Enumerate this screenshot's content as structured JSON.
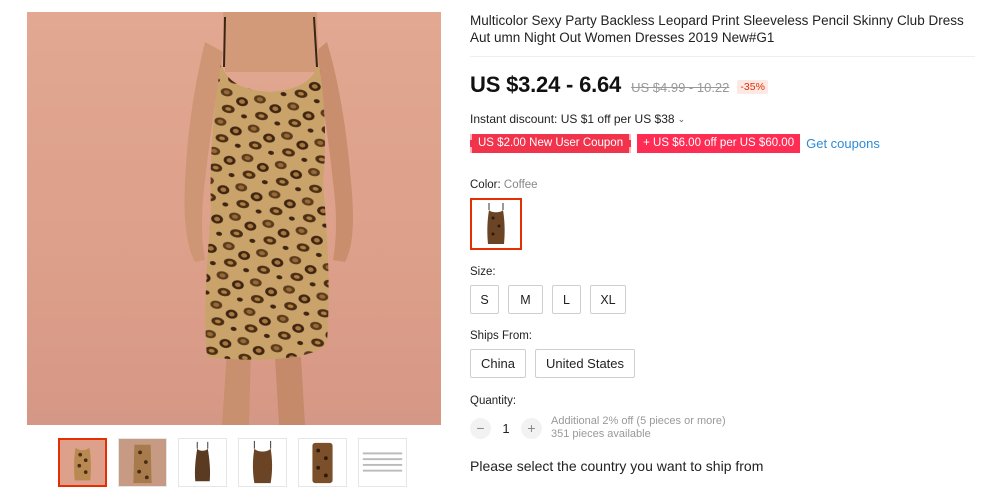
{
  "product": {
    "title": "Multicolor Sexy Party Backless Leopard Print Sleeveless Pencil Skinny Club Dress Aut umn Night Out Women Dresses 2019 New#G1",
    "price": "US $3.24 - 6.64",
    "original_price": "US $4.99 - 10.22",
    "discount": "-35%"
  },
  "promotions": {
    "instant_discount": "Instant discount: US $1 off per US $38",
    "coupon_new_user": "US $2.00 New User Coupon",
    "coupon_store": "+ US $6.00 off per US $60.00",
    "get_coupons": "Get coupons"
  },
  "color": {
    "label": "Color:",
    "selected": "Coffee"
  },
  "size": {
    "label": "Size:",
    "options": [
      "S",
      "M",
      "L",
      "XL"
    ]
  },
  "ships_from": {
    "label": "Ships From:",
    "options": [
      "China",
      "United States"
    ]
  },
  "quantity": {
    "label": "Quantity:",
    "value": "1",
    "decrease": "−",
    "increase": "+",
    "note": "Additional 2% off (5 pieces or more)",
    "available": "351 pieces available"
  },
  "shipping": {
    "prompt": "Please select the country you want to ship from"
  },
  "colors": {
    "accent": "#e62e04",
    "coupon": "#f1334c",
    "link": "#2d8bd8",
    "background_photo": "#dfa38d"
  },
  "gallery": {
    "thumbnail_count": 6,
    "selected_index": 0
  }
}
